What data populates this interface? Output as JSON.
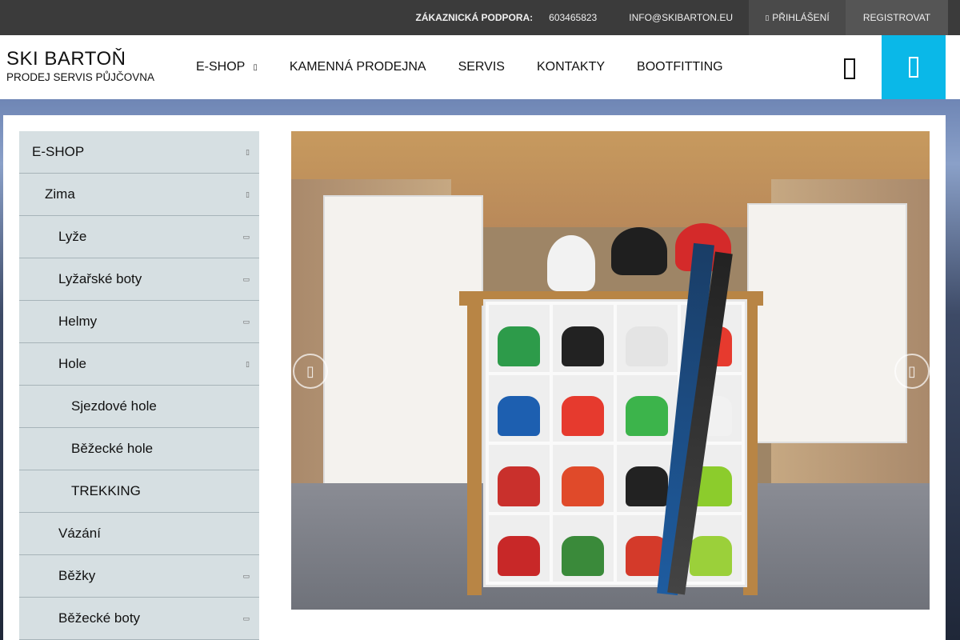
{
  "topbar": {
    "support_label": "ZÁKAZNICKÁ PODPORA:",
    "phone": "603465823",
    "email": "INFO@SKIBARTON.EU",
    "login": "PŘIHLÁŠENÍ",
    "register": "REGISTROVAT"
  },
  "header": {
    "logo_title": "SKI BARTOŇ",
    "logo_subtitle": "PRODEJ SERVIS PŮJČOVNA",
    "nav": [
      {
        "label": "E-SHOP",
        "has_dropdown": true
      },
      {
        "label": "KAMENNÁ PRODEJNA"
      },
      {
        "label": "SERVIS"
      },
      {
        "label": "KONTAKTY"
      },
      {
        "label": "BOOTFITTING"
      }
    ],
    "search_icon": "search-icon",
    "cart_icon": "cart-icon"
  },
  "sidebar": {
    "items": [
      {
        "label": "E-SHOP",
        "level": 0,
        "expandable": true
      },
      {
        "label": "Zima",
        "level": 1,
        "expandable": true
      },
      {
        "label": "Lyže",
        "level": 2,
        "expandable": true
      },
      {
        "label": "Lyžařské boty",
        "level": 2,
        "expandable": true
      },
      {
        "label": "Helmy",
        "level": 2,
        "expandable": true
      },
      {
        "label": "Hole",
        "level": 2,
        "expandable": true
      },
      {
        "label": "Sjezdové hole",
        "level": 3,
        "expandable": false
      },
      {
        "label": "Běžecké hole",
        "level": 3,
        "expandable": false
      },
      {
        "label": "TREKKING",
        "level": 3,
        "expandable": false
      },
      {
        "label": "Vázání",
        "level": 2,
        "expandable": false
      },
      {
        "label": "Běžky",
        "level": 2,
        "expandable": true
      },
      {
        "label": "Běžecké boty",
        "level": 2,
        "expandable": true
      }
    ]
  },
  "colors": {
    "topbar_bg": "#3b3b3b",
    "cart_accent": "#0ab8e8",
    "sidebar_bg": "#d6dfe2"
  }
}
